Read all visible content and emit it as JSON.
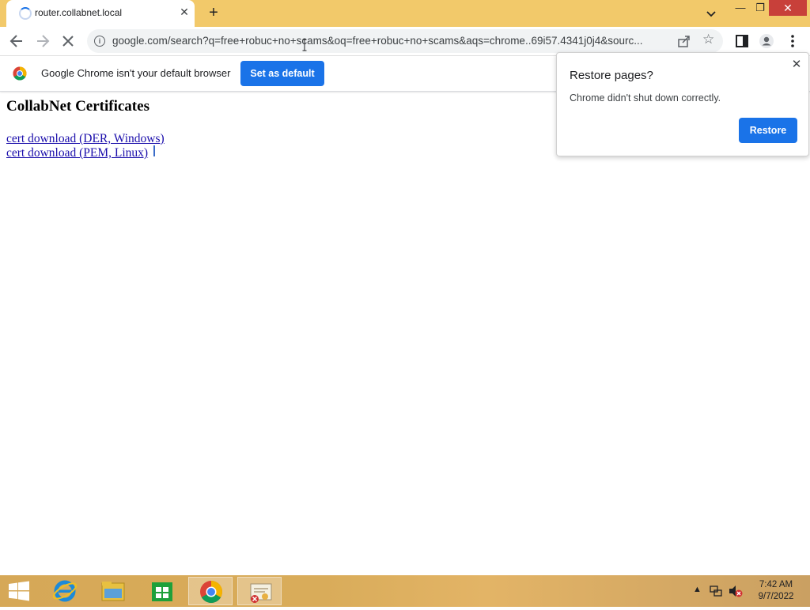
{
  "browser": {
    "tab_title": "router.collabnet.local",
    "url": "google.com/search?q=free+robuc+no+scams&oq=free+robuc+no+scams&aqs=chrome..69i57.4341j0j4&sourc..."
  },
  "infobar": {
    "message": "Google Chrome isn't your default browser",
    "button_label": "Set as default"
  },
  "page": {
    "heading": "CollabNet Certificates",
    "links": [
      "cert download (DER, Windows)",
      "cert download (PEM, Linux)"
    ]
  },
  "restore_popup": {
    "title": "Restore pages?",
    "message": "Chrome didn't shut down correctly.",
    "button_label": "Restore"
  },
  "taskbar": {
    "time": "7:42 AM",
    "date": "9/7/2022"
  },
  "colors": {
    "titlebar": "#f2c96a",
    "accent": "#1a73e8",
    "close_button": "#c8403a"
  }
}
